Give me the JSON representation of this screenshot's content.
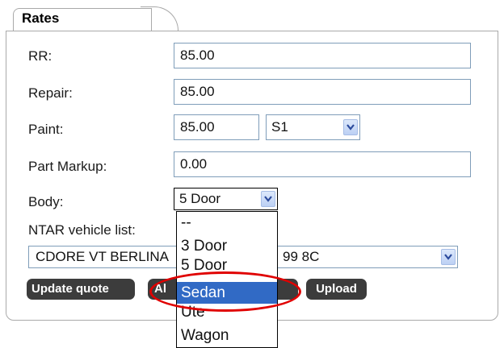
{
  "section_tab": {
    "label": "Rates"
  },
  "fields": {
    "rr": {
      "label": "RR:",
      "value": "85.00"
    },
    "repair": {
      "label": "Repair:",
      "value": "85.00"
    },
    "paint": {
      "label": "Paint:",
      "value": "85.00",
      "code_selected": "S1"
    },
    "part_markup": {
      "label": "Part Markup:",
      "value": "0.00"
    },
    "body": {
      "label": "Body:",
      "selected": "5 Door"
    },
    "ntar": {
      "label": "NTAR vehicle list:",
      "selected": "CDORE VT BERLINA",
      "selected_tail": "99 8C"
    }
  },
  "buttons": {
    "update_quote": "Update quote",
    "second_partial": "Al",
    "upload": "Upload"
  },
  "body_dropdown": {
    "options": [
      "--",
      "3 Door",
      "5 Door",
      "Sedan",
      "Ute",
      "Wagon"
    ],
    "highlighted": "Sedan"
  },
  "colors": {
    "highlight": "#316ac5",
    "annotation": "#e00000",
    "button": "#3c3c3c"
  }
}
